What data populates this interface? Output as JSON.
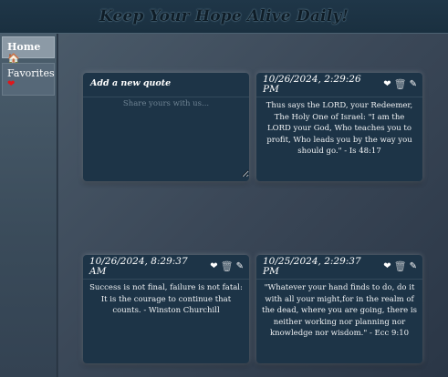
{
  "header": {
    "title": "Keep Your Hope Alive Daily!"
  },
  "sidebar": {
    "items": [
      {
        "label": "Home",
        "icon": "🏠"
      },
      {
        "label": "Favorites",
        "icon": "❤"
      }
    ]
  },
  "new_quote": {
    "title": "Add a new quote",
    "placeholder": "Share yours with us..."
  },
  "cards": [
    {
      "date": "10/26/2024, 2:29:26 PM",
      "text": "Thus says the LORD, your Redeemer, The Holy One of Israel: \"I am the LORD your God, Who teaches you to profit, Who leads you by the way you should go.\" - Is 48:17"
    },
    {
      "date": "10/26/2024, 8:29:37 AM",
      "text": "Success is not final, failure is not fatal: It is the courage to continue that counts. - Winston Churchill"
    },
    {
      "date": "10/25/2024, 2:29:37 PM",
      "text": "\"Whatever your hand finds to do, do it with all your might,for in the realm of the dead, where you are going, there is neither working nor planning nor knowledge nor wisdom.\" - Ecc 9:10"
    }
  ],
  "icons": {
    "favorite": "❤",
    "delete": "🗑",
    "edit": "✎"
  },
  "colors": {
    "heart": "#e0161b",
    "card_bg": "#1d3447",
    "header_bg": "#1f3648"
  }
}
